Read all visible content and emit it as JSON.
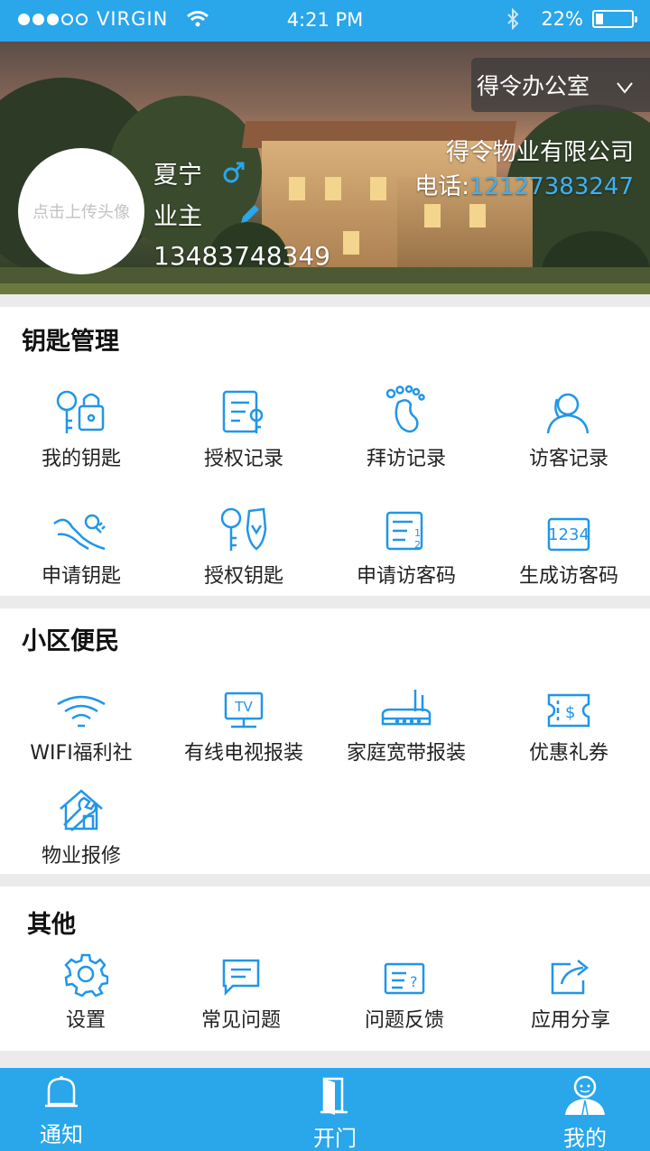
{
  "status_bar": {
    "carrier": "VIRGIN",
    "time": "4:21 PM",
    "battery": "22%",
    "battery_level": 0.22
  },
  "header": {
    "office_selector": "得令办公室",
    "company_name": "得令物业有限公司",
    "phone_label": "电话:",
    "phone_value": "12127383247",
    "avatar_placeholder": "点击上传头像",
    "user_name": "夏宁",
    "user_role": "业主",
    "user_phone": "13483748349"
  },
  "sections": {
    "keys": {
      "title": "钥匙管理",
      "items": [
        {
          "label": "我的钥匙",
          "icon": "key-lock-icon"
        },
        {
          "label": "授权记录",
          "icon": "auth-record-icon"
        },
        {
          "label": "拜访记录",
          "icon": "footprint-icon"
        },
        {
          "label": "访客记录",
          "icon": "visitors-icon"
        },
        {
          "label": "申请钥匙",
          "icon": "hand-key-icon"
        },
        {
          "label": "授权钥匙",
          "icon": "key-shield-icon"
        },
        {
          "label": "申请访客码",
          "icon": "numbered-list-icon"
        },
        {
          "label": "生成访客码",
          "icon": "code-1234-icon"
        }
      ],
      "code_text": "1234"
    },
    "community": {
      "title": "小区便民",
      "items": [
        {
          "label": "WIFI福利社",
          "icon": "wifi-icon"
        },
        {
          "label": "有线电视报装",
          "icon": "tv-icon"
        },
        {
          "label": "家庭宽带报装",
          "icon": "router-icon"
        },
        {
          "label": "优惠礼券",
          "icon": "coupon-icon"
        },
        {
          "label": "物业报修",
          "icon": "house-repair-icon"
        }
      ],
      "tv_text": "TV"
    },
    "other": {
      "title": "其他",
      "items": [
        {
          "label": "设置",
          "icon": "gear-icon"
        },
        {
          "label": "常见问题",
          "icon": "chat-icon"
        },
        {
          "label": "问题反馈",
          "icon": "feedback-icon"
        },
        {
          "label": "应用分享",
          "icon": "share-icon"
        }
      ]
    }
  },
  "tabbar": {
    "tabs": [
      {
        "label": "通知",
        "icon": "bell-icon"
      },
      {
        "label": "开门",
        "icon": "door-icon"
      },
      {
        "label": "我的",
        "icon": "user-icon"
      }
    ]
  },
  "colors": {
    "accent": "#2aa6ea",
    "icon_blue": "#2196e8"
  }
}
